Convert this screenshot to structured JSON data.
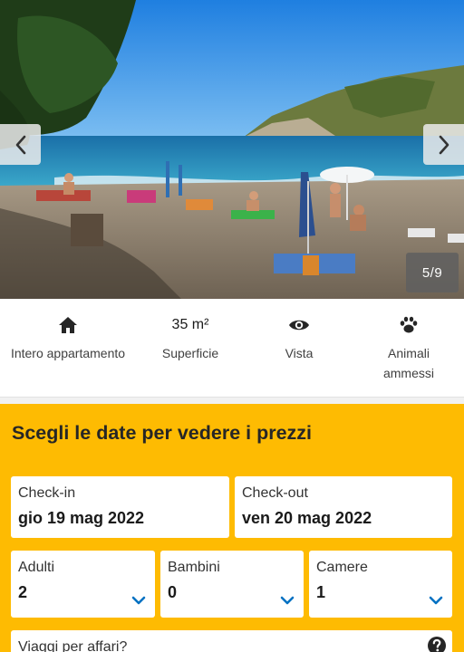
{
  "gallery": {
    "counter": "5/9",
    "prev_icon": "chevron-left-icon",
    "next_icon": "chevron-right-icon"
  },
  "amenities": [
    {
      "icon": "home-icon",
      "label": "Intero appartamento"
    },
    {
      "icon_text": "35 m²",
      "label": "Superficie"
    },
    {
      "icon": "eye-icon",
      "label": "Vista"
    },
    {
      "icon": "paw-icon",
      "label": "Animali ammessi"
    }
  ],
  "search": {
    "title": "Scegli le date per vedere i prezzi",
    "checkin": {
      "label": "Check-in",
      "value": "gio 19 mag 2022"
    },
    "checkout": {
      "label": "Check-out",
      "value": "ven 20 mag 2022"
    },
    "adults": {
      "label": "Adulti",
      "value": "2"
    },
    "children": {
      "label": "Bambini",
      "value": "0"
    },
    "rooms": {
      "label": "Camere",
      "value": "1"
    },
    "business": {
      "label": "Viaggi per affari?",
      "help_icon": "question-circle-icon"
    }
  },
  "colors": {
    "panel_bg": "#febb02",
    "chevron_blue": "#0071c2"
  }
}
